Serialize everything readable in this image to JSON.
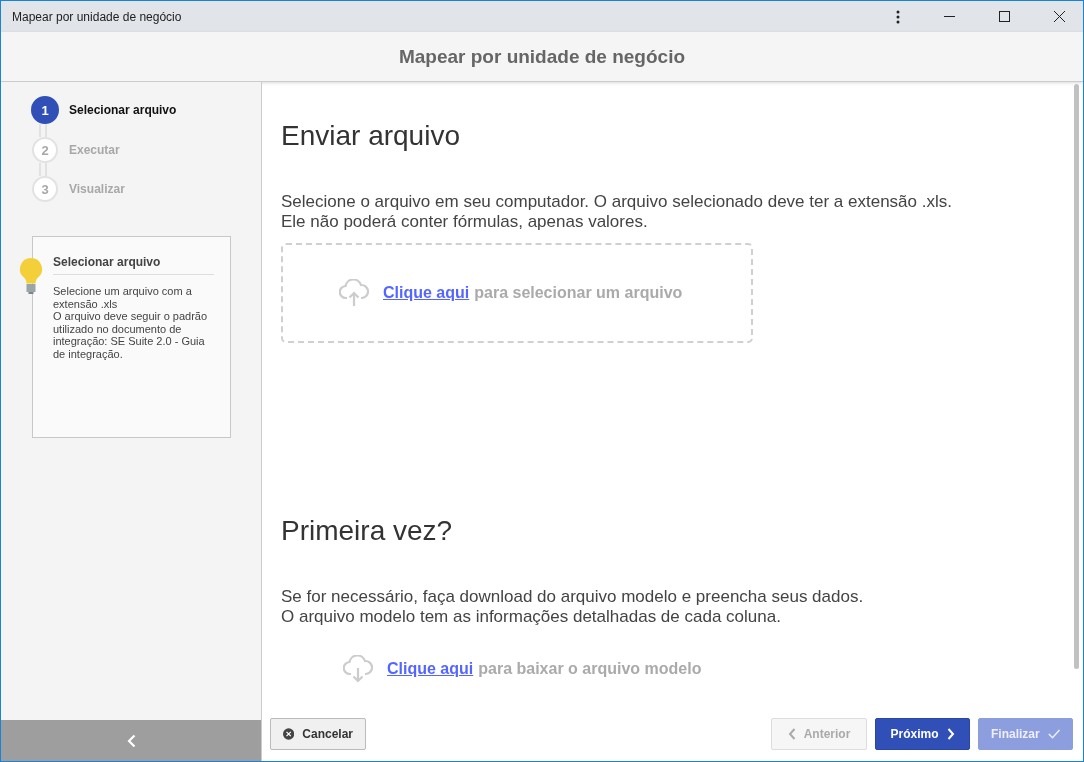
{
  "window": {
    "title": "Mapear por unidade de negócio"
  },
  "header": {
    "title": "Mapear por unidade de negócio"
  },
  "steps": [
    {
      "number": "1",
      "label": "Selecionar arquivo",
      "selected": true
    },
    {
      "number": "2",
      "label": "Executar",
      "selected": false
    },
    {
      "number": "3",
      "label": "Visualizar",
      "selected": false
    }
  ],
  "hint": {
    "title": "Selecionar arquivo",
    "lines": [
      "Selecione um arquivo com a extensão .xls",
      "O arquivo deve seguir o padrão utilizado no documento de integração: SE Suite 2.0 - Guia de integração."
    ]
  },
  "upload": {
    "heading": "Enviar arquivo",
    "lines": [
      "Selecione o arquivo em seu computador. O arquivo selecionado deve ter a extensão .xls.",
      "Ele não poderá conter fórmulas, apenas valores."
    ],
    "link": "Clique aqui",
    "text": "para selecionar um arquivo"
  },
  "first_time": {
    "heading": "Primeira vez?",
    "lines": [
      "Se for necessário, faça download do arquivo modelo e preencha seus dados.",
      "O arquivo modelo tem as informações detalhadas de cada coluna."
    ],
    "link": "Clique aqui",
    "text": "para baixar o arquivo modelo"
  },
  "buttons": [
    {
      "kind": "cancel",
      "label": "Cancelar",
      "disabled": false
    },
    {
      "kind": "back",
      "label": "Anterior",
      "disabled": true
    },
    {
      "kind": "next",
      "label": "Próximo",
      "disabled": false
    },
    {
      "kind": "finish",
      "label": "Finalizar",
      "disabled": true
    }
  ]
}
